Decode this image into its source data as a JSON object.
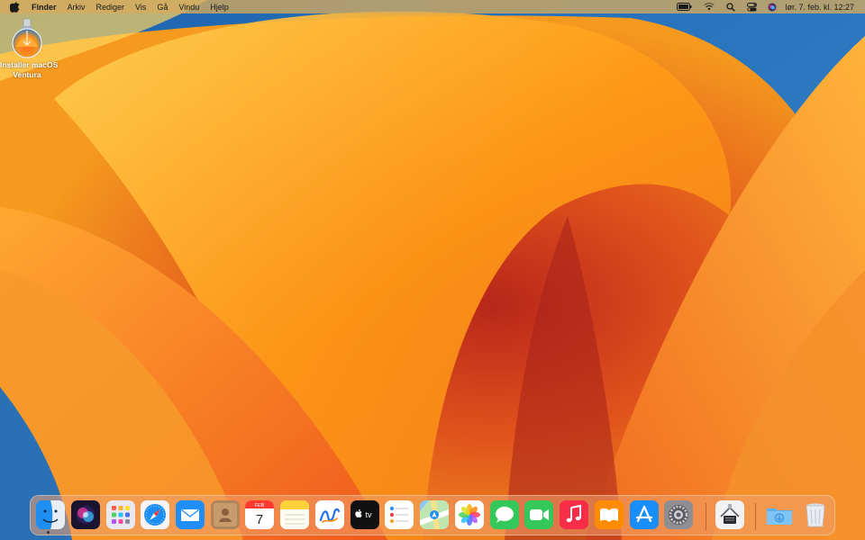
{
  "menubar": {
    "items": [
      "Finder",
      "Arkiv",
      "Rediger",
      "Vis",
      "Gå",
      "Vindu",
      "Hjelp"
    ],
    "clock": "lør. 7. feb. kl. 12:27"
  },
  "desktop": {
    "icons": [
      {
        "label_line1": "Installer macOS",
        "label_line2": "Ventura"
      }
    ]
  },
  "calendar": {
    "month": "FEB",
    "day": "7"
  },
  "appletv": {
    "label": "tv"
  },
  "dock": {
    "apps": [
      "Finder",
      "Siri",
      "Launchpad",
      "Safari",
      "Mail",
      "Kontakter",
      "Kalender",
      "Notater",
      "Freeform",
      "Apple TV",
      "Påminnelser",
      "Kart",
      "Bilder",
      "Meldinger",
      "FaceTime",
      "Musikk",
      "Bøker",
      "App Store",
      "Systeminnstillinger",
      "Installer macOS Ventura",
      "Nedlastinger",
      "Papirkurv"
    ]
  }
}
